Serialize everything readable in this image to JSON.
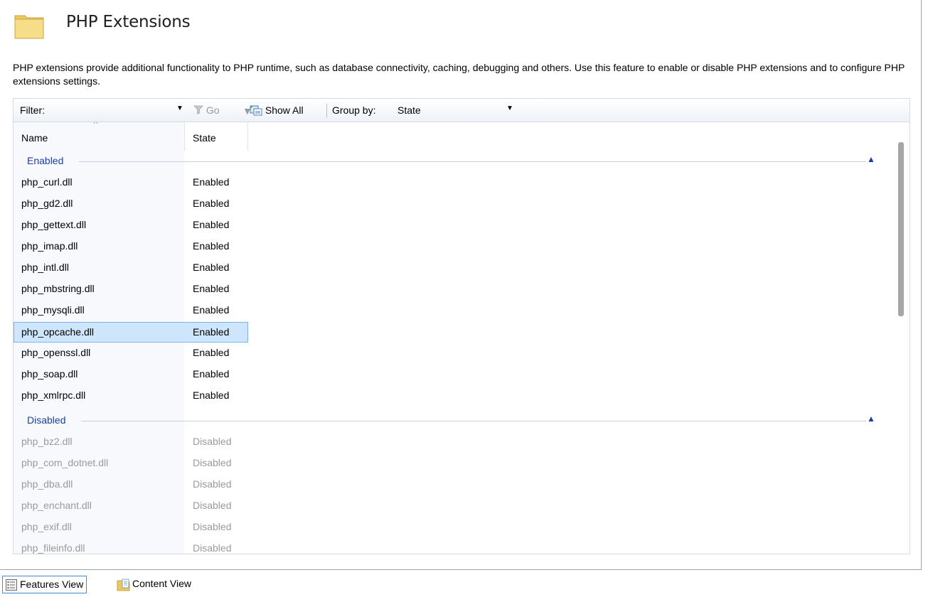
{
  "header": {
    "title": "PHP Extensions",
    "description": "PHP extensions provide additional functionality to PHP runtime, such as database connectivity, caching, debugging and others. Use this feature to enable or disable PHP extensions and to configure PHP extensions settings."
  },
  "toolbar": {
    "filter_label": "Filter:",
    "filter_value": "",
    "go_label": "Go",
    "show_all_label": "Show All",
    "group_by_label": "Group by:",
    "group_by_value": "State"
  },
  "list": {
    "columns": [
      "Name",
      "State"
    ],
    "groups": [
      {
        "label": "Enabled",
        "rows": [
          {
            "name": "php_curl.dll",
            "state": "Enabled"
          },
          {
            "name": "php_gd2.dll",
            "state": "Enabled"
          },
          {
            "name": "php_gettext.dll",
            "state": "Enabled"
          },
          {
            "name": "php_imap.dll",
            "state": "Enabled"
          },
          {
            "name": "php_intl.dll",
            "state": "Enabled"
          },
          {
            "name": "php_mbstring.dll",
            "state": "Enabled"
          },
          {
            "name": "php_mysqli.dll",
            "state": "Enabled"
          },
          {
            "name": "php_opcache.dll",
            "state": "Enabled",
            "selected": true
          },
          {
            "name": "php_openssl.dll",
            "state": "Enabled"
          },
          {
            "name": "php_soap.dll",
            "state": "Enabled"
          },
          {
            "name": "php_xmlrpc.dll",
            "state": "Enabled"
          }
        ]
      },
      {
        "label": "Disabled",
        "rows": [
          {
            "name": "php_bz2.dll",
            "state": "Disabled"
          },
          {
            "name": "php_com_dotnet.dll",
            "state": "Disabled"
          },
          {
            "name": "php_dba.dll",
            "state": "Disabled"
          },
          {
            "name": "php_enchant.dll",
            "state": "Disabled"
          },
          {
            "name": "php_exif.dll",
            "state": "Disabled"
          },
          {
            "name": "php_fileinfo.dll",
            "state": "Disabled"
          }
        ]
      }
    ]
  },
  "tabs": {
    "features_view": "Features View",
    "content_view": "Content View"
  },
  "colors": {
    "group_header": "#1a3fa6",
    "selection_bg": "#cde6fb",
    "selection_border": "#7eb4ea",
    "disabled_text": "#9a9a9a"
  }
}
